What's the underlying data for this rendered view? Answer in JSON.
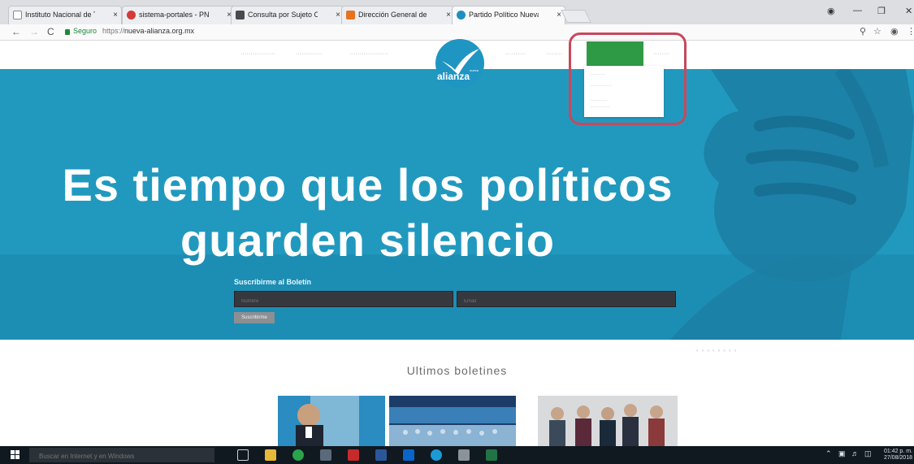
{
  "browser": {
    "tabs": [
      {
        "title": "Instituto Nacional de Tra",
        "close": "×"
      },
      {
        "title": "sistema-portales - PNT",
        "close": "×"
      },
      {
        "title": "Consulta por Sujeto Obl",
        "close": "×"
      },
      {
        "title": "Dirección General de En",
        "close": "×"
      },
      {
        "title": "Partido Político Nueva A",
        "close": "×"
      }
    ],
    "back": "←",
    "forward": "→",
    "reload": "C",
    "secure_label": "Seguro",
    "url_scheme": "https://",
    "url_host": "nueva-alianza.org.mx"
  },
  "site": {
    "logo_text": "alianza",
    "logo_small": "nueva",
    "headline_line1": "Es tiempo que los políticos",
    "headline_line2": "guarden silencio",
    "subscribe": {
      "title": "Suscribirme al Boletín",
      "name_placeholder": "Nombre",
      "email_placeholder": "Email",
      "button": "Suscribirme"
    },
    "bulletins_title": "Ultimos boletines"
  },
  "taskbar": {
    "search_placeholder": "Buscar en Internet y en Windows",
    "time": "01:42 p. m.",
    "date": "27/08/2018"
  },
  "colors": {
    "hero": "#2199bf",
    "nav_active": "#2e9a45",
    "highlight": "#c7485c"
  }
}
